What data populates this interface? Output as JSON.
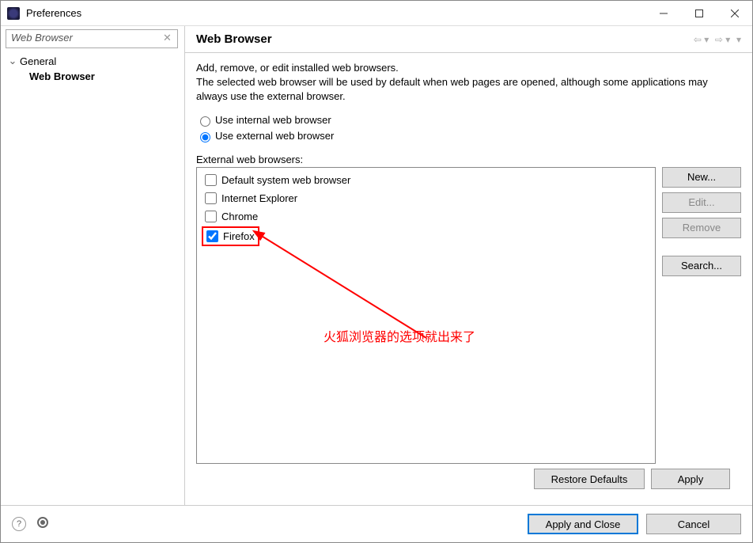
{
  "window": {
    "title": "Preferences"
  },
  "filter": {
    "placeholder": "Web Browser"
  },
  "tree": {
    "root": "General",
    "child": "Web Browser"
  },
  "page": {
    "heading": "Web Browser",
    "description1": "Add, remove, or edit installed web browsers.",
    "description2": "The selected web browser will be used by default when web pages are opened, although some applications may always use the external browser.",
    "radio_internal": "Use internal web browser",
    "radio_external": "Use external web browser",
    "ext_label": "External web browsers:",
    "browsers": [
      {
        "label": "Default system web browser",
        "checked": false
      },
      {
        "label": "Internet Explorer",
        "checked": false
      },
      {
        "label": "Chrome",
        "checked": false
      },
      {
        "label": "Firefox",
        "checked": true
      }
    ],
    "buttons": {
      "new": "New...",
      "edit": "Edit...",
      "remove": "Remove",
      "search": "Search..."
    },
    "restore": "Restore Defaults",
    "apply": "Apply",
    "apply_close": "Apply and Close",
    "cancel": "Cancel"
  },
  "annotation": {
    "text": "火狐浏览器的选项就出来了"
  }
}
